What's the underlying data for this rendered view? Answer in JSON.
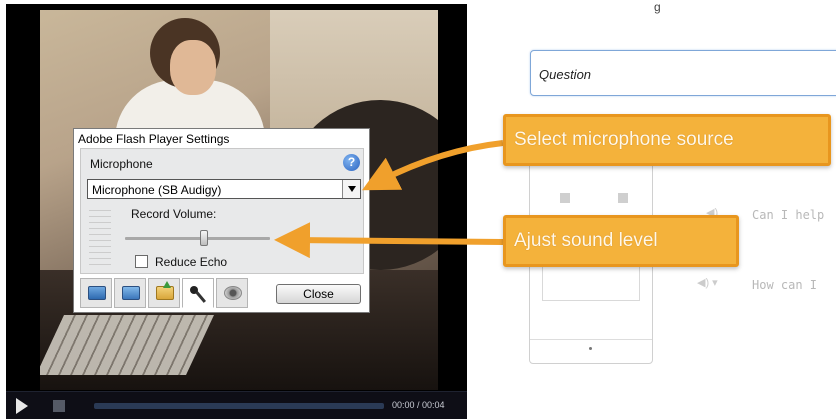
{
  "player": {
    "time_display": "00:00 / 00:04"
  },
  "flash_dialog": {
    "title": "Adobe Flash Player Settings",
    "microphone_label": "Microphone",
    "help_icon": "question-mark-icon",
    "microphone_select": {
      "selected": "Microphone (SB Audigy)"
    },
    "record_volume_label": "Record Volume:",
    "record_volume_level": 0.55,
    "reduce_echo": {
      "label": "Reduce Echo",
      "checked": false
    },
    "tabs": [
      {
        "icon": "privacy-monitor-icon",
        "active": false
      },
      {
        "icon": "storage-monitor-icon",
        "active": false
      },
      {
        "icon": "local-storage-folder-icon",
        "active": false
      },
      {
        "icon": "microphone-icon",
        "active": true
      },
      {
        "icon": "camera-icon",
        "active": false
      }
    ],
    "close_label": "Close"
  },
  "form": {
    "header_glyph": "g",
    "question_placeholder": "Question",
    "hint_1": "Can I help",
    "hint_2": "How can I"
  },
  "callouts": {
    "select_mic": "Select microphone source",
    "adjust_sound": "Ajust sound level"
  },
  "colors": {
    "callout_fill": "#f4b23b",
    "callout_border": "#e8961e",
    "question_border": "#7fa7d8",
    "player_bar": "#0e0e16"
  }
}
